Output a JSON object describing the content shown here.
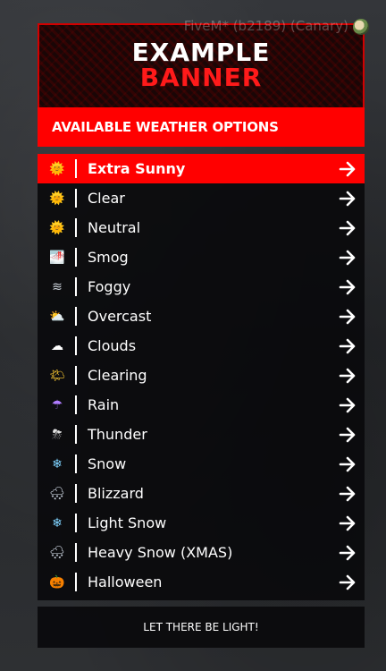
{
  "overlay": {
    "watermark": "FiveM* (b2189) (Canary)"
  },
  "menu": {
    "banner": {
      "line1": "EXAMPLE",
      "line2": "BANNER"
    },
    "subtitle": "AVAILABLE WEATHER OPTIONS",
    "items": [
      {
        "label": "Extra Sunny",
        "icon": "sun-icon",
        "glyph": "🌞",
        "selected": true
      },
      {
        "label": "Clear",
        "icon": "sun-icon",
        "glyph": "🌞",
        "selected": false
      },
      {
        "label": "Neutral",
        "icon": "sun-icon",
        "glyph": "🌞",
        "selected": false
      },
      {
        "label": "Smog",
        "icon": "smog-icon",
        "glyph": "🌁",
        "selected": false
      },
      {
        "label": "Foggy",
        "icon": "fog-icon",
        "glyph": "≋",
        "selected": false
      },
      {
        "label": "Overcast",
        "icon": "sun-behind-cloud-icon",
        "glyph": "⛅",
        "selected": false
      },
      {
        "label": "Clouds",
        "icon": "cloud-icon",
        "glyph": "☁",
        "selected": false
      },
      {
        "label": "Clearing",
        "icon": "sun-behind-small-cloud-icon",
        "glyph": "🌤",
        "selected": false
      },
      {
        "label": "Rain",
        "icon": "umbrella-icon",
        "glyph": "☂",
        "selected": false
      },
      {
        "label": "Thunder",
        "icon": "thunder-cloud-icon",
        "glyph": "⛈",
        "selected": false
      },
      {
        "label": "Snow",
        "icon": "snowflake-icon",
        "glyph": "❄",
        "selected": false
      },
      {
        "label": "Blizzard",
        "icon": "snow-cloud-icon",
        "glyph": "🌨",
        "selected": false
      },
      {
        "label": "Light Snow",
        "icon": "snowflake-icon",
        "glyph": "❄",
        "selected": false
      },
      {
        "label": "Heavy Snow (XMAS)",
        "icon": "snow-cloud-icon",
        "glyph": "🌨",
        "selected": false
      },
      {
        "label": "Halloween",
        "icon": "pumpkin-icon",
        "glyph": "🎃",
        "selected": false
      }
    ],
    "footer": "LET THERE BE LIGHT!"
  },
  "colors": {
    "accent": "#ff0000",
    "panel": "#0a0a0c",
    "text": "#ffffff"
  }
}
